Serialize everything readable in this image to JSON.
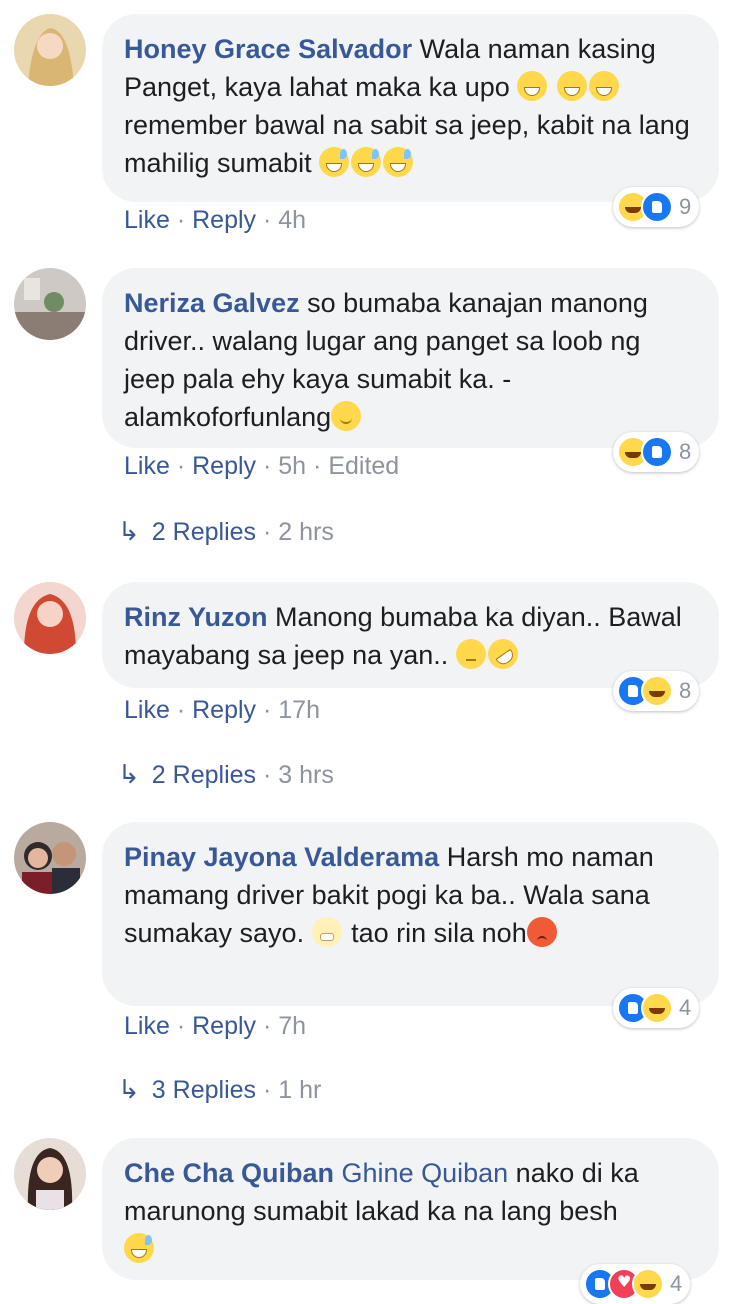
{
  "comments": [
    {
      "author": "Honey Grace Salvador",
      "text1": "Wala naman kasing Panget, kaya lahat maka ka upo",
      "text2": "remember bawal na sabit sa jeep, kabit na lang mahilig sumabit",
      "like": "Like",
      "reply": "Reply",
      "time": "4h",
      "reaction_count": "9",
      "avatar_colors": [
        "#e7c98b",
        "#b58a4a"
      ]
    },
    {
      "author": "Neriza Galvez",
      "text1": "so bumaba kanajan manong driver.. walang lugar ang panget sa loob ng jeep pala ehy kaya sumabit ka. -alamkoforfunlang",
      "like": "Like",
      "reply": "Reply",
      "time": "5h",
      "edited": "Edited",
      "reaction_count": "8",
      "replies_label": "2 Replies",
      "replies_time": "2 hrs",
      "avatar_colors": [
        "#c9c3c0",
        "#5b6b58"
      ]
    },
    {
      "author": "Rinz Yuzon",
      "text1": "Manong bumaba ka diyan.. Bawal mayabang sa jeep na yan..",
      "like": "Like",
      "reply": "Reply",
      "time": "17h",
      "reaction_count": "8",
      "replies_label": "2 Replies",
      "replies_time": "3 hrs",
      "avatar_colors": [
        "#f2b7a6",
        "#c9422f"
      ]
    },
    {
      "author": "Pinay Jayona Valderama",
      "text1": "Harsh mo naman mamang driver bakit pogi ka ba.. Wala sana sumakay sayo.",
      "text2": "tao rin sila noh",
      "like": "Like",
      "reply": "Reply",
      "time": "7h",
      "reaction_count": "4",
      "replies_label": "3 Replies",
      "replies_time": "1 hr",
      "avatar_colors": [
        "#3b3a3c",
        "#8a6a52"
      ]
    },
    {
      "author": "Che Cha Quiban",
      "mention": "Ghine Quiban",
      "text1": "nako di ka marunong sumabit lakad ka na lang besh",
      "reaction_count": "4",
      "avatar_colors": [
        "#d9cfc8",
        "#4a3028"
      ]
    }
  ],
  "separator": "·"
}
